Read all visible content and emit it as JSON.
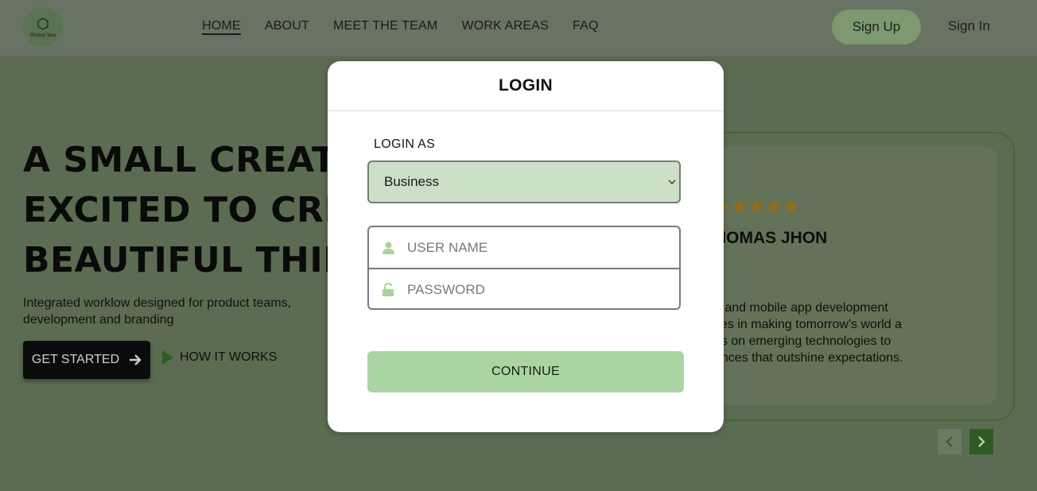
{
  "header": {
    "logo_text": "Honey bee",
    "nav": [
      "HOME",
      "ABOUT",
      "MEET THE TEAM",
      "WORK AREAS",
      "FAQ"
    ],
    "signup_label": "Sign Up",
    "signin_label": "Sign In"
  },
  "hero": {
    "title_line1": "A SMALL CREATIV",
    "title_line2": "EXCITED TO CREAT",
    "title_line3": "BEAUTIFUL THING",
    "subtitle": "Integrated worklow designed for product teams, development and branding",
    "get_started_label": "GET STARTED",
    "how_it_works_label": "HOW IT WORKS"
  },
  "testimonial": {
    "rating_stars": 5,
    "stars_text": "★★★★★",
    "name": "HOMAS JHON",
    "text": "b and mobile app development\nves in making tomorrow's world a\nus on emerging technologies to\nences that outshine expectations."
  },
  "modal": {
    "title": "LOGIN",
    "login_as_label": "LOGIN AS",
    "login_as_value": "Business",
    "username_placeholder": "USER NAME",
    "password_placeholder": "PASSWORD",
    "continue_label": "CONTINUE"
  },
  "colors": {
    "page_bg": "#5b6c52",
    "select_bg": "#cce0c8",
    "continue_bg": "#abd4a3",
    "accent_dark": "#2f5a22"
  },
  "icons": {
    "user": "user-icon",
    "lock": "unlock-icon",
    "arrow": "arrow-right-icon",
    "play": "play-icon"
  }
}
